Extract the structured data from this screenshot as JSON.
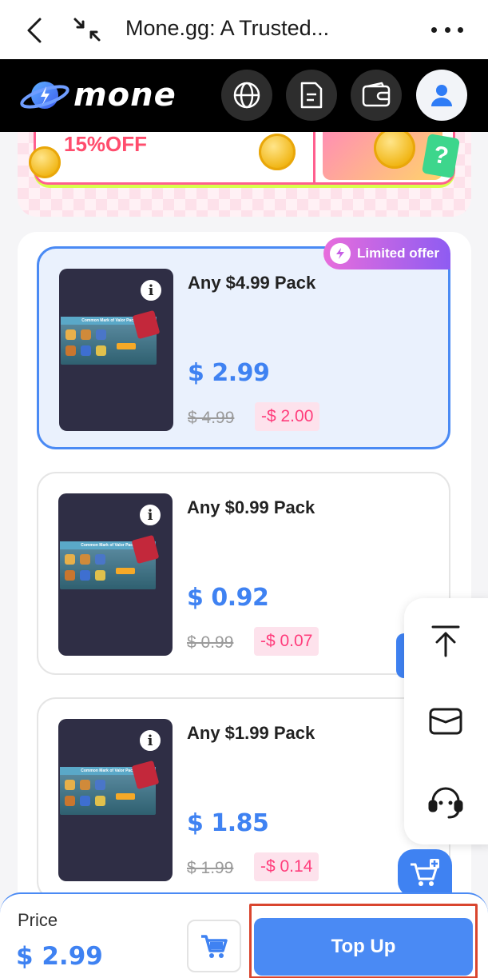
{
  "browser": {
    "title": "Mone.gg: A Trusted..."
  },
  "header": {
    "logo_text": "mone",
    "icons": [
      "globe-icon",
      "document-icon",
      "wallet-icon",
      "user-icon"
    ]
  },
  "banner": {
    "discount_text": "15%OFF"
  },
  "products": [
    {
      "name": "Any $4.99 Pack",
      "price": "$ 2.99",
      "original_price": "$ 4.99",
      "discount": "-$ 2.00",
      "badge": "Limited offer",
      "selected": true
    },
    {
      "name": "Any $0.99 Pack",
      "price": "$ 0.92",
      "original_price": "$ 0.99",
      "discount": "-$ 0.07",
      "selected": false
    },
    {
      "name": "Any $1.99 Pack",
      "price": "$ 1.85",
      "original_price": "$ 1.99",
      "discount": "-$ 0.14",
      "selected": false
    }
  ],
  "thumbnail": {
    "pack_title": "Common Mark of Valor Pack"
  },
  "side_tools": [
    "back-to-top-icon",
    "mail-icon",
    "support-icon"
  ],
  "bottom": {
    "price_label": "Price",
    "price_value": "$ 2.99",
    "topup_label": "Top Up"
  },
  "colors": {
    "accent": "#3f82f2",
    "discount": "#ff3d7c",
    "highlight_border": "#d9452e"
  }
}
